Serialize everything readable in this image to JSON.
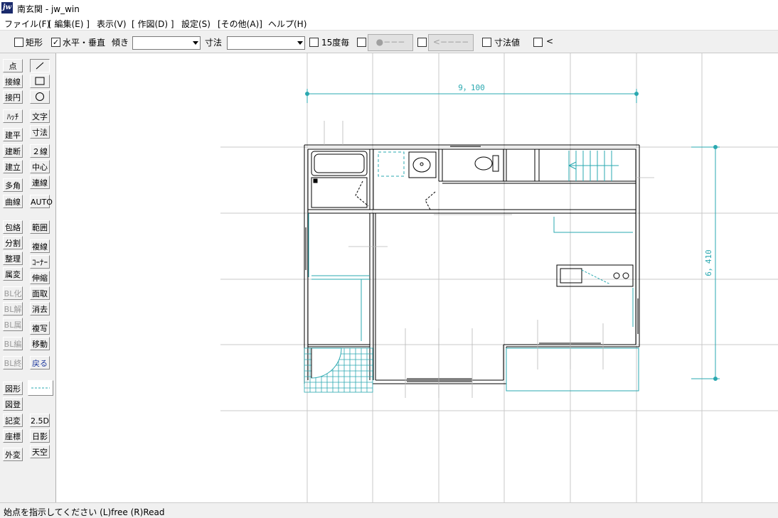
{
  "window": {
    "title": "南玄関 - jw_win",
    "app_icon": "jw"
  },
  "menu": [
    "ファイル(F)",
    "[ 編集(E) ]",
    "表示(V)",
    "[ 作図(D) ]",
    "設定(S)",
    "[その他(A)]",
    "ヘルプ(H)"
  ],
  "toolbar": {
    "rect_label": "矩形",
    "hv_label": "水平・垂直",
    "hv_checked": "✓",
    "slope_label": "傾き",
    "dim_label": "寸法",
    "deg15_label": "15度毎",
    "btn_dot_line": "●−−−",
    "btn_arrow_line": "<−−−−",
    "dimval_label": "寸法値",
    "lt_label": "<"
  },
  "left_tools": {
    "col1": [
      "点",
      "接線",
      "接円",
      "ﾊｯﾁ",
      "建平",
      "建断",
      "建立",
      "多角形",
      "曲線",
      "包絡",
      "分割",
      "整理",
      "属変",
      "BL化",
      "BL解",
      "BL属",
      "BL編",
      "BL終",
      "図形",
      "図登",
      "記変",
      "座標",
      "外変"
    ],
    "col2": [
      "文字",
      "寸法",
      "２線",
      "中心線",
      "連線",
      "AUTO",
      "範囲",
      "複線",
      "ｺｰﾅｰ",
      "伸縮",
      "面取",
      "消去",
      "複写",
      "移動",
      "戻る",
      "2.5D",
      "日影",
      "天空"
    ]
  },
  "drawing": {
    "width_dim": "9，100",
    "height_dim": "6，410",
    "colors": {
      "dim": "#2aa8b0",
      "grid": "#c8c8c8",
      "wall": "#000000"
    }
  },
  "status": {
    "text": "始点を指示してください (L)free (R)Read"
  }
}
